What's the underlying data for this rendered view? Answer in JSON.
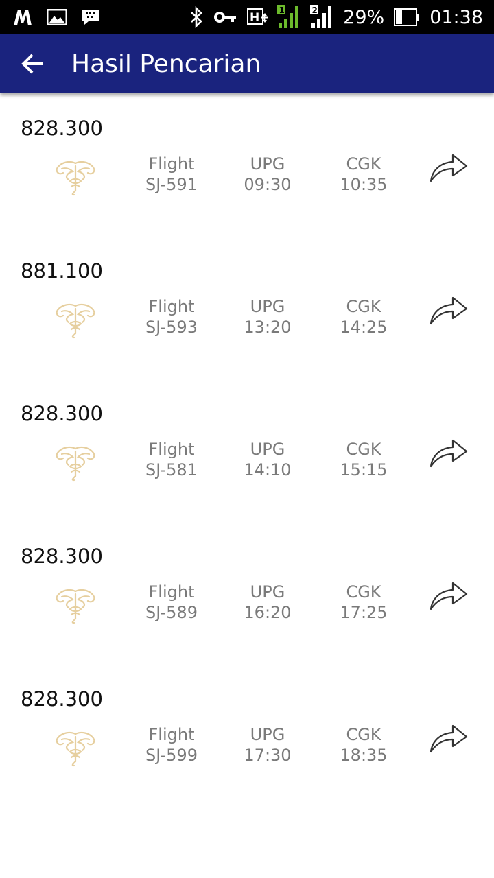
{
  "status_bar": {
    "battery": "29%",
    "time": "01:38",
    "network": "H+",
    "sim2": "2",
    "icons": [
      "m-app-icon",
      "gallery-icon",
      "bbm-icon",
      "bluetooth-icon",
      "vpn-key-icon",
      "network-hplus-icon",
      "signal-sim1-icon",
      "signal-sim2-icon",
      "battery-icon"
    ]
  },
  "appbar": {
    "title": "Hasil Pencarian",
    "back_icon": "arrow-left-icon"
  },
  "colors": {
    "appbar": "#1a237e",
    "statusbar": "#000000",
    "logo": "#e6cf9f",
    "secondary_text": "#7a7a7a",
    "signal_green": "#6dbb2c"
  },
  "flights": [
    {
      "price": "828.300",
      "label": "Flight",
      "code": "SJ-591",
      "from": "UPG",
      "depart": "09:30",
      "to": "CGK",
      "arrive": "10:35"
    },
    {
      "price": "881.100",
      "label": "Flight",
      "code": "SJ-593",
      "from": "UPG",
      "depart": "13:20",
      "to": "CGK",
      "arrive": "14:25"
    },
    {
      "price": "828.300",
      "label": "Flight",
      "code": "SJ-581",
      "from": "UPG",
      "depart": "14:10",
      "to": "CGK",
      "arrive": "15:15"
    },
    {
      "price": "828.300",
      "label": "Flight",
      "code": "SJ-589",
      "from": "UPG",
      "depart": "16:20",
      "to": "CGK",
      "arrive": "17:25"
    },
    {
      "price": "828.300",
      "label": "Flight",
      "code": "SJ-599",
      "from": "UPG",
      "depart": "17:30",
      "to": "CGK",
      "arrive": "18:35"
    }
  ]
}
